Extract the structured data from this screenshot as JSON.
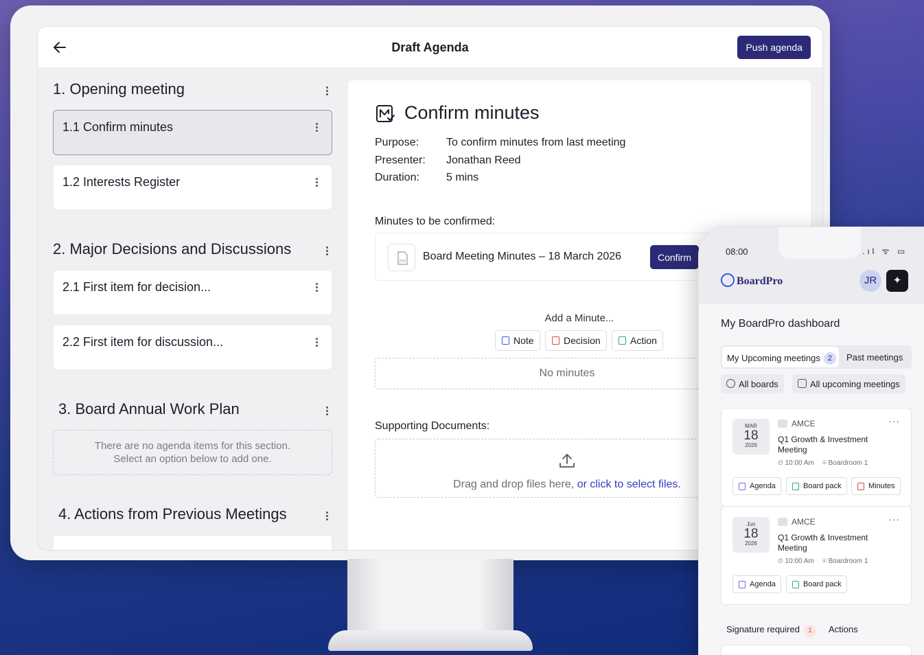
{
  "desktop": {
    "title": "Draft Agenda",
    "push_label": "Push agenda",
    "sections": [
      {
        "title": "1. Opening meeting"
      },
      {
        "title": "2. Major Decisions and Discussions"
      },
      {
        "title": "3. Board Annual Work Plan"
      },
      {
        "title": "4. Actions from Previous Meetings"
      }
    ],
    "items": [
      {
        "label": "1.1  Confirm minutes"
      },
      {
        "label": "1.2  Interests Register"
      },
      {
        "label": "2.1  First item for decision..."
      },
      {
        "label": "2.2 First item for discussion..."
      }
    ],
    "empty_line1": "There are no agenda items for this section.",
    "empty_line2": "Select an option below to add one.",
    "detail": {
      "title": "Confirm minutes",
      "purpose_k": "Purpose:",
      "purpose_v": "To confirm minutes from last meeting",
      "presenter_k": "Presenter:",
      "presenter_v": "Jonathan Reed",
      "duration_k": "Duration:",
      "duration_v": "5 mins",
      "minutes_head": "Minutes to be confirmed:",
      "doc_name": "Board Meeting Minutes – 18 March 2026",
      "pdf_label": "PDF",
      "confirm_label": "Confirm",
      "add_minute": "Add a Minute...",
      "chip_note": "Note",
      "chip_decision": "Decision",
      "chip_action": "Action",
      "no_minutes": "No minutes",
      "supporting_head": "Supporting Documents:",
      "drop_text": "Drag and drop files here, ",
      "drop_link": "or click to select files."
    }
  },
  "phone": {
    "time": "08:00",
    "status": ".ıl ᯤ ▭",
    "brand": "BoardPro",
    "avatar": "JR",
    "spark": "✦",
    "dashboard_title": "My BoardPro dashboard",
    "tab_upcoming": "My Upcoming meetings",
    "tab_upcoming_count": "2",
    "tab_past": "Past meetings",
    "filter_boards": "All boards",
    "filter_meetings": "All upcoming meetings",
    "more": "···",
    "meetings": [
      {
        "month": "MAR",
        "day": "18",
        "year": "2026",
        "org": "AMCE",
        "name": "Q1 Growth & Investment Meeting",
        "time": "⏲ 10:00 Am",
        "room": "⌾ Boardroom 1",
        "btn_agenda": "Agenda",
        "btn_pack": "Board pack",
        "btn_minutes": "Minutes"
      },
      {
        "month": "Jun",
        "day": "18",
        "year": "2026",
        "org": "AMCE",
        "name": "Q1 Growth & Investment Meeting",
        "time": "⏲ 10:00 Am",
        "room": "⌾ Boardroom 1",
        "btn_agenda": "Agenda",
        "btn_pack": "Board pack"
      }
    ],
    "signature_label": "Signature required",
    "signature_count": "1",
    "actions_label": "Actions"
  },
  "colors": {
    "primary": "#2c2a76",
    "link": "#3837c4",
    "decision": "#d44a4a",
    "action": "#3aa86a",
    "note": "#3b5be0"
  }
}
